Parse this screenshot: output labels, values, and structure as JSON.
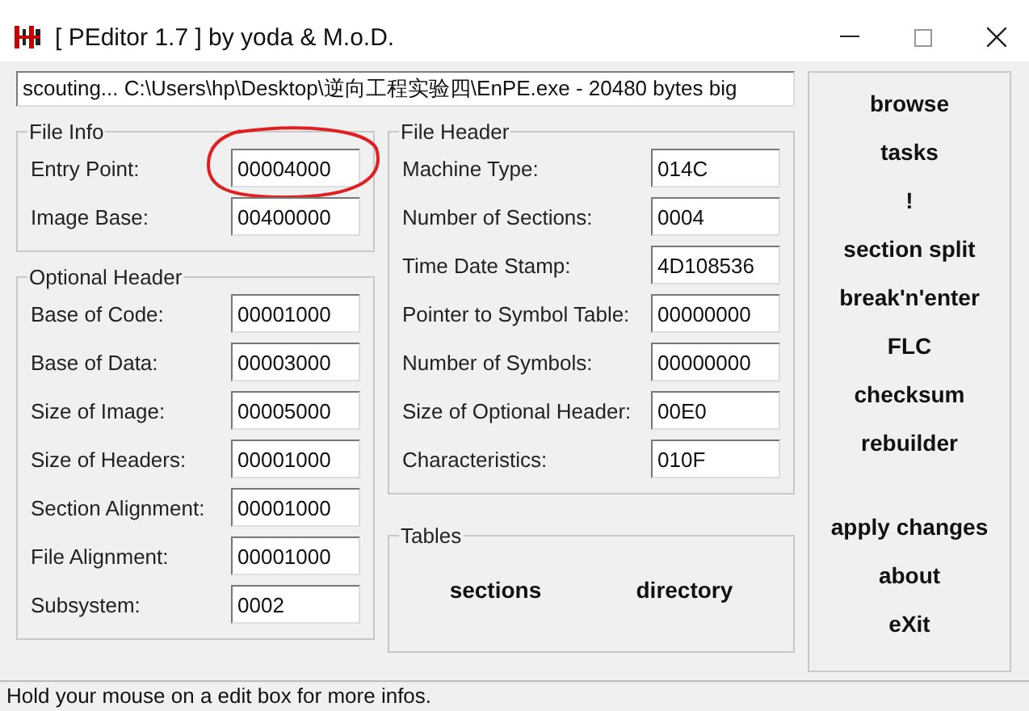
{
  "window": {
    "title": "[ PEditor 1.7 ]  by yoda & M.o.D."
  },
  "path_field": {
    "value": "scouting... C:\\Users\\hp\\Desktop\\逆向工程实验四\\EnPE.exe - 20480 bytes big"
  },
  "file_info": {
    "title": "File Info",
    "fields": [
      {
        "label": "Entry Point:",
        "value": "00004000",
        "circled": true
      },
      {
        "label": "Image Base:",
        "value": "00400000",
        "circled": false
      }
    ]
  },
  "optional_header": {
    "title": "Optional Header",
    "fields": [
      {
        "label": "Base of Code:",
        "value": "00001000"
      },
      {
        "label": "Base of Data:",
        "value": "00003000"
      },
      {
        "label": "Size of Image:",
        "value": "00005000"
      },
      {
        "label": "Size of Headers:",
        "value": "00001000"
      },
      {
        "label": "Section Alignment:",
        "value": "00001000"
      },
      {
        "label": "File Alignment:",
        "value": "00001000"
      },
      {
        "label": "Subsystem:",
        "value": "0002"
      }
    ]
  },
  "file_header": {
    "title": "File Header",
    "fields": [
      {
        "label": "Machine Type:",
        "value": "014C"
      },
      {
        "label": "Number of Sections:",
        "value": "0004"
      },
      {
        "label": "Time Date Stamp:",
        "value": "4D108536"
      },
      {
        "label": "Pointer to Symbol Table:",
        "value": "00000000"
      },
      {
        "label": "Number of Symbols:",
        "value": "00000000"
      },
      {
        "label": "Size of Optional Header:",
        "value": "00E0"
      },
      {
        "label": "Characteristics:",
        "value": "010F"
      }
    ]
  },
  "tables": {
    "title": "Tables",
    "buttons": [
      "sections",
      "directory"
    ]
  },
  "side_buttons": {
    "tools": [
      "browse",
      "tasks",
      "!",
      "section split",
      "break'n'enter",
      "FLC",
      "checksum",
      "rebuilder"
    ],
    "actions": [
      "apply changes",
      "about",
      "eXit"
    ]
  },
  "status_bar": "Hold your mouse on a edit box for more infos."
}
